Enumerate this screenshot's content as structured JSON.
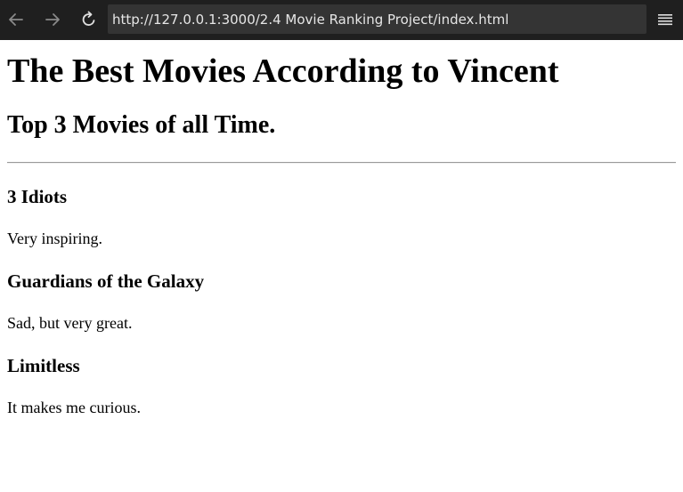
{
  "browser": {
    "url": "http://127.0.0.1:3000/2.4 Movie Ranking Project/index.html",
    "colors": {
      "toolbar_bg": "#1f1f1f",
      "urlbar_bg": "#343434",
      "icon_disabled": "#8a8a8a",
      "icon_enabled": "#e0e0e0"
    }
  },
  "page": {
    "title": "The Best Movies According to Vincent",
    "subtitle": "Top 3 Movies of all Time.",
    "movies": [
      {
        "title": "3 Idiots",
        "description": "Very inspiring."
      },
      {
        "title": "Guardians of the Galaxy",
        "description": "Sad, but very great."
      },
      {
        "title": "Limitless",
        "description": "It makes me curious."
      }
    ]
  }
}
